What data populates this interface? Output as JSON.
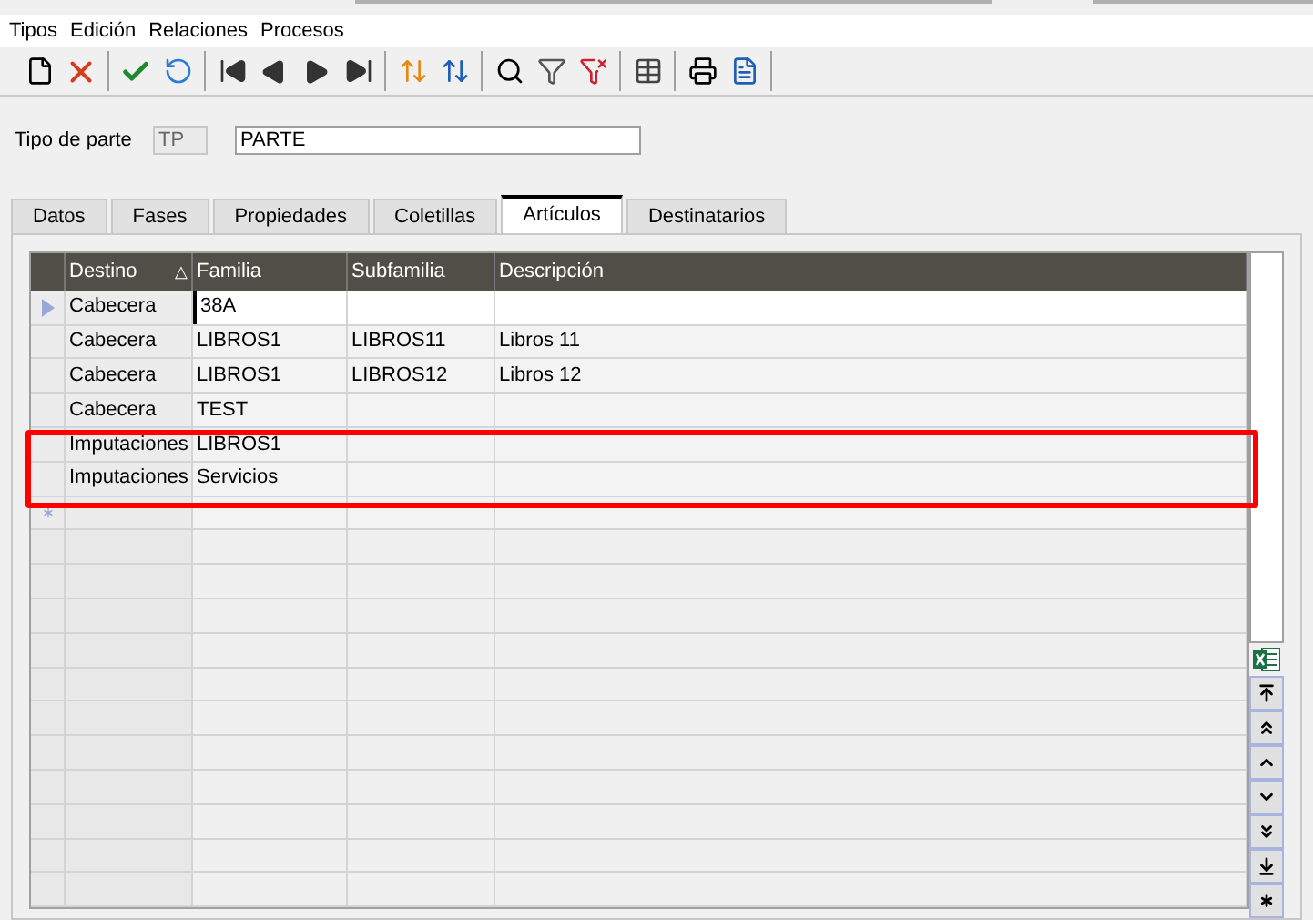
{
  "menu": [
    "Tipos",
    "Edición",
    "Relaciones",
    "Procesos"
  ],
  "form": {
    "label": "Tipo de parte",
    "code": "TP",
    "value": "PARTE"
  },
  "tabs": [
    {
      "label": "Datos",
      "selected": false
    },
    {
      "label": "Fases",
      "selected": false
    },
    {
      "label": "Propiedades",
      "selected": false
    },
    {
      "label": "Coletillas",
      "selected": false
    },
    {
      "label": "Artículos",
      "selected": true
    },
    {
      "label": "Destinatarios",
      "selected": false
    }
  ],
  "table": {
    "columns": [
      "Destino",
      "Familia",
      "Subfamilia",
      "Descripción"
    ],
    "sort_indicator": "△",
    "rows": [
      {
        "current": true,
        "cells": [
          "Cabecera",
          "38A",
          "",
          ""
        ]
      },
      {
        "current": false,
        "cells": [
          "Cabecera",
          "LIBROS1",
          "LIBROS11",
          "Libros 11"
        ]
      },
      {
        "current": false,
        "cells": [
          "Cabecera",
          "LIBROS1",
          "LIBROS12",
          "Libros 12"
        ]
      },
      {
        "current": false,
        "cells": [
          "Cabecera",
          "TEST",
          "",
          ""
        ]
      },
      {
        "current": false,
        "cells": [
          "Imputaciones",
          "LIBROS1",
          "",
          ""
        ]
      },
      {
        "current": false,
        "cells": [
          "Imputaciones",
          "Servicios",
          "",
          ""
        ]
      }
    ]
  }
}
